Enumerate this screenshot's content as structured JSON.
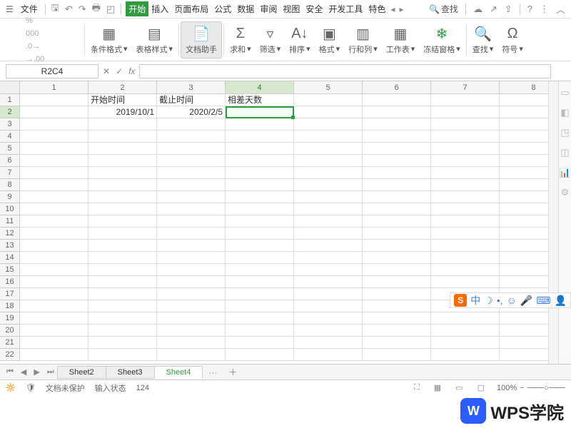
{
  "menubar": {
    "file": "文件",
    "search": "查找",
    "tabs": [
      "开始",
      "插入",
      "页面布局",
      "公式",
      "数据",
      "审阅",
      "视图",
      "安全",
      "开发工具",
      "特色"
    ],
    "active_tab_index": 0
  },
  "ribbon": {
    "cond_format": "条件格式",
    "table_style": "表格样式",
    "doc_helper": "文档助手",
    "sum": "求和",
    "filter": "筛选",
    "sort": "排序",
    "format": "格式",
    "rowcol": "行和列",
    "worksheet": "工作表",
    "freeze": "冻结窗格",
    "find": "查找",
    "symbol": "符号"
  },
  "formula_bar": {
    "name_box": "R2C4",
    "fx": "fx"
  },
  "sheet": {
    "columns": [
      "1",
      "2",
      "3",
      "4",
      "5",
      "6",
      "7",
      "8"
    ],
    "active_col_index": 3,
    "rows_count": 22,
    "active_row_index": 1,
    "data": {
      "r1": {
        "c2": "开始时间",
        "c3": "截止时间",
        "c4": "相差天数"
      },
      "r2": {
        "c2": "2019/10/1",
        "c3": "2020/2/5"
      }
    },
    "selection": {
      "row": 2,
      "col": 4
    }
  },
  "sheet_tabs": {
    "tabs": [
      "Sheet2",
      "Sheet3",
      "Sheet4"
    ],
    "active_index": 2,
    "more": "···"
  },
  "status_bar": {
    "protect": "文档未保护",
    "input_mode": "输入状态",
    "value": "124",
    "zoom": "100%"
  },
  "ime": {
    "lang": "中"
  },
  "watermark": {
    "logo": "W",
    "text": "WPS学院"
  }
}
